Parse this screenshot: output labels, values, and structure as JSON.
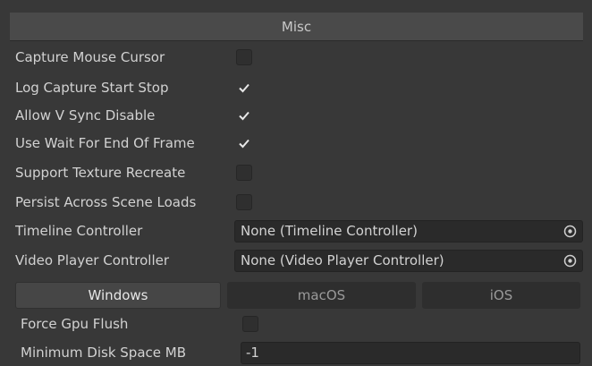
{
  "section_title": "Misc",
  "rows": [
    {
      "label": "Capture Mouse Cursor",
      "checked": false
    },
    {
      "label": "Log Capture Start Stop",
      "checked": true
    },
    {
      "label": "Allow V Sync Disable",
      "checked": true
    },
    {
      "label": "Use Wait For End Of Frame",
      "checked": true
    },
    {
      "label": "Support Texture Recreate",
      "checked": false
    },
    {
      "label": "Persist Across Scene Loads",
      "checked": false
    }
  ],
  "object_fields": [
    {
      "label": "Timeline Controller",
      "value": "None (Timeline Controller)"
    },
    {
      "label": "Video Player Controller",
      "value": "None (Video Player Controller)"
    }
  ],
  "platform_tabs": [
    {
      "label": "Windows",
      "active": true
    },
    {
      "label": "macOS",
      "active": false
    },
    {
      "label": "iOS",
      "active": false
    }
  ],
  "windows": {
    "force_gpu_flush_label": "Force Gpu Flush",
    "force_gpu_flush_checked": false,
    "min_disk_space_label": "Minimum Disk Space MB",
    "min_disk_space_value": "-1"
  },
  "icons": {
    "check": "checkmark-icon",
    "picker": "object-picker-icon"
  }
}
